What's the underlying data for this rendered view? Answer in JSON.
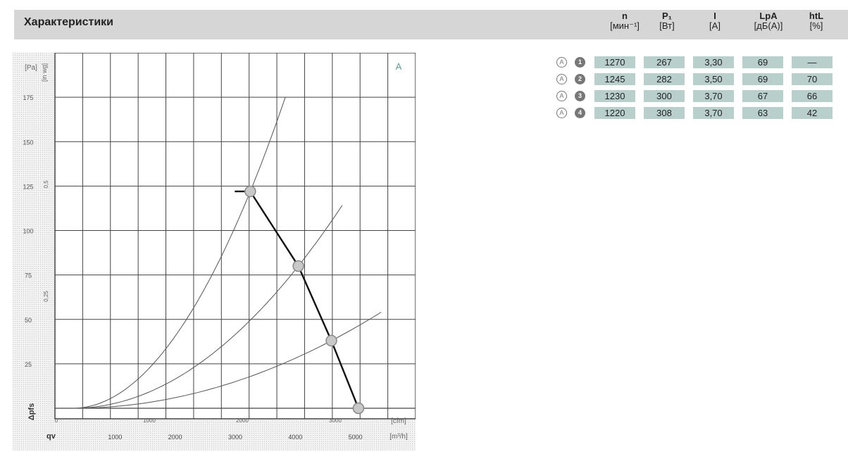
{
  "section_title": "Характеристики",
  "table": {
    "columns": [
      {
        "label": "n",
        "unit": "[мин⁻¹]"
      },
      {
        "label": "P₁",
        "unit": "[Вт]"
      },
      {
        "label": "I",
        "unit": "[A]"
      },
      {
        "label": "LpA",
        "unit": "[дБ(A)]"
      },
      {
        "label": "htL",
        "unit": "[%]"
      }
    ],
    "rows": [
      {
        "mode": "A",
        "point": "1",
        "values": [
          "1270",
          "267",
          "3,30",
          "69",
          "—"
        ]
      },
      {
        "mode": "A",
        "point": "2",
        "values": [
          "1245",
          "282",
          "3,50",
          "69",
          "70"
        ]
      },
      {
        "mode": "A",
        "point": "3",
        "values": [
          "1230",
          "300",
          "3,70",
          "67",
          "66"
        ]
      },
      {
        "mode": "A",
        "point": "4",
        "values": [
          "1220",
          "308",
          "3,70",
          "63",
          "42"
        ]
      }
    ]
  },
  "chart_data": {
    "type": "line",
    "curve_label": "A",
    "y_unit": "[Pa]",
    "y_unit_alt": "[in wg]",
    "x_unit_bottom": "[m³/h]",
    "x_unit_top": "[cfm]",
    "y_symbol": "Δpfs",
    "x_symbol": "qv",
    "y_ticks": [
      25,
      50,
      75,
      100,
      125,
      150,
      175
    ],
    "y_alt_ticks": [
      "0,5",
      "0,25"
    ],
    "x_bottom_ticks": [
      1000,
      2000,
      3000,
      4000,
      5000
    ],
    "x_top_ticks": [
      "0",
      "1000",
      "2000",
      "3000"
    ],
    "xlim": [
      0,
      6000
    ],
    "ylim": [
      0,
      200
    ],
    "fan_curve": [
      {
        "x": 3250,
        "y": 122
      },
      {
        "x": 4050,
        "y": 80
      },
      {
        "x": 4600,
        "y": 38
      },
      {
        "x": 5050,
        "y": 0
      }
    ],
    "system_curves": [
      {
        "k": 122,
        "xp": 3250
      },
      {
        "k": 80,
        "xp": 4050
      },
      {
        "k": 38,
        "xp": 4600
      }
    ],
    "operating_points": [
      {
        "label": "1",
        "x": 3250,
        "y": 122
      },
      {
        "label": "2",
        "x": 4050,
        "y": 80
      },
      {
        "label": "3",
        "x": 4600,
        "y": 38
      },
      {
        "label": "4",
        "x": 5050,
        "y": 0
      }
    ],
    "grid": true
  }
}
